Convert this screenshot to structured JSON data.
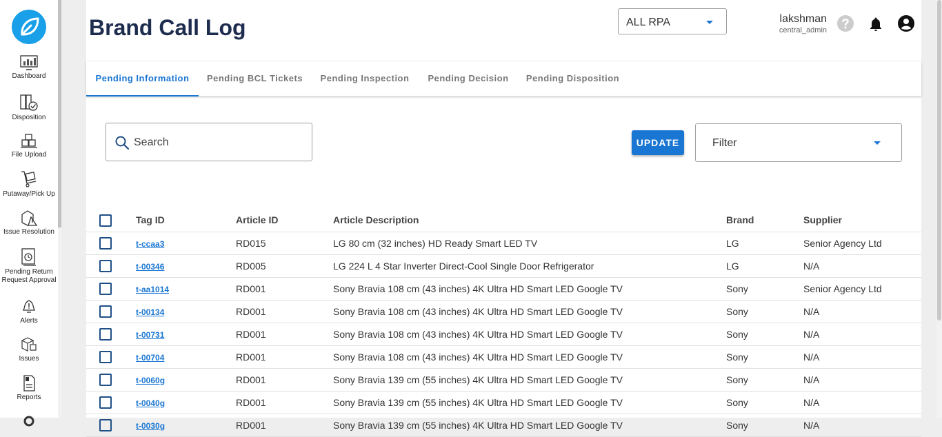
{
  "sidebar": {
    "items": [
      {
        "label": "Dashboard",
        "icon": "dashboard-icon"
      },
      {
        "label": "Disposition",
        "icon": "disposition-icon"
      },
      {
        "label": "File Upload",
        "icon": "file-upload-icon"
      },
      {
        "label": "Putaway/Pick Up",
        "icon": "putaway-cart-icon"
      },
      {
        "label": "Issue Resolution",
        "icon": "issue-resolution-icon"
      },
      {
        "label": "Pending Return Request Approval",
        "icon": "pending-return-icon"
      },
      {
        "label": "Alerts",
        "icon": "alert-bell-icon"
      },
      {
        "label": "Issues",
        "icon": "issues-box-icon"
      },
      {
        "label": "Reports",
        "icon": "reports-icon"
      }
    ]
  },
  "header": {
    "title": "Brand Call Log",
    "rpa_select": "ALL RPA",
    "user_name": "lakshman",
    "user_role": "central_admin"
  },
  "tabs": [
    "Pending Information",
    "Pending BCL Tickets",
    "Pending Inspection",
    "Pending Decision",
    "Pending Disposition"
  ],
  "controls": {
    "search_placeholder": "Search",
    "update_label": "UPDATE",
    "filter_label": "Filter"
  },
  "table": {
    "columns": [
      "Tag ID",
      "Article ID",
      "Article Description",
      "Brand",
      "Supplier"
    ],
    "rows": [
      {
        "tag": "t-ccaa3",
        "article": "RD015",
        "desc": "LG 80 cm (32 inches) HD Ready Smart LED TV",
        "brand": "LG",
        "supplier": "Senior Agency Ltd"
      },
      {
        "tag": "t-00346",
        "article": "RD005",
        "desc": "LG 224 L 4 Star Inverter Direct-Cool Single Door Refrigerator",
        "brand": "LG",
        "supplier": "N/A"
      },
      {
        "tag": "t-aa1014",
        "article": "RD001",
        "desc": "Sony Bravia 108 cm (43 inches) 4K Ultra HD Smart LED Google TV",
        "brand": "Sony",
        "supplier": "Senior Agency Ltd"
      },
      {
        "tag": "t-00134",
        "article": "RD001",
        "desc": "Sony Bravia 108 cm (43 inches) 4K Ultra HD Smart LED Google TV",
        "brand": "Sony",
        "supplier": "N/A"
      },
      {
        "tag": "t-00731",
        "article": "RD001",
        "desc": "Sony Bravia 108 cm (43 inches) 4K Ultra HD Smart LED Google TV",
        "brand": "Sony",
        "supplier": "N/A"
      },
      {
        "tag": "t-00704",
        "article": "RD001",
        "desc": "Sony Bravia 108 cm (43 inches) 4K Ultra HD Smart LED Google TV",
        "brand": "Sony",
        "supplier": "N/A"
      },
      {
        "tag": "t-0060g",
        "article": "RD001",
        "desc": "Sony Bravia 139 cm (55 inches) 4K Ultra HD Smart LED Google TV",
        "brand": "Sony",
        "supplier": "N/A"
      },
      {
        "tag": "t-0040g",
        "article": "RD001",
        "desc": "Sony Bravia 139 cm (55 inches) 4K Ultra HD Smart LED Google TV",
        "brand": "Sony",
        "supplier": "N/A"
      },
      {
        "tag": "t-0030g",
        "article": "RD001",
        "desc": "Sony Bravia 139 cm (55 inches) 4K Ultra HD Smart LED Google TV",
        "brand": "Sony",
        "supplier": "N/A"
      }
    ]
  },
  "colors": {
    "accent": "#1976d2",
    "title": "#1e2d4f",
    "logo": "#1aa0e8"
  }
}
